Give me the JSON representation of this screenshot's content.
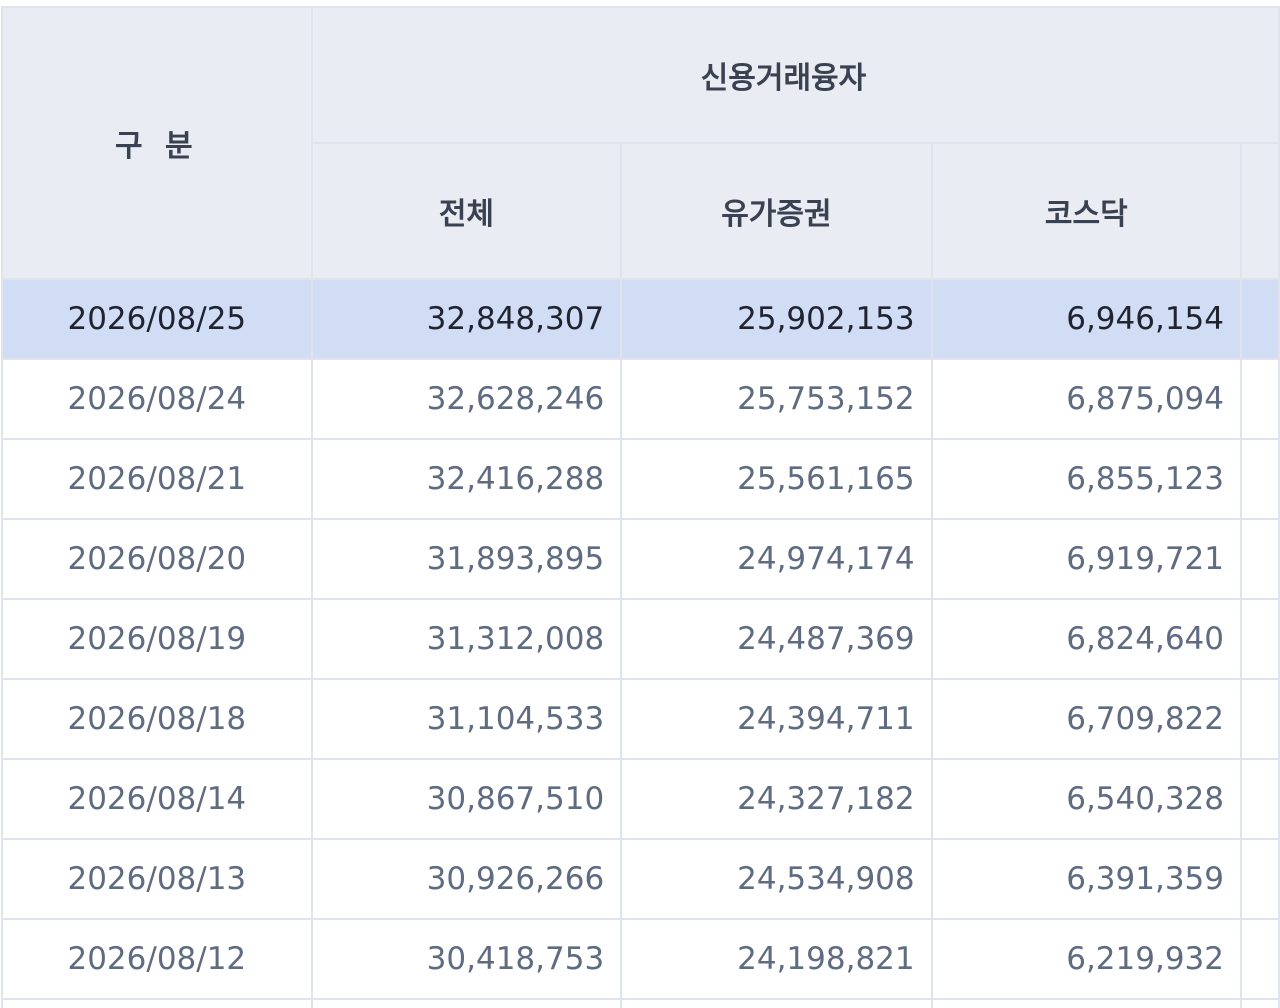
{
  "table": {
    "header": {
      "division_label": "구 분",
      "group_label": "신용거래융자",
      "sub_labels": [
        "전체",
        "유가증권",
        "코스닥"
      ]
    },
    "rows": [
      {
        "date": "2026/08/25",
        "total": "32,848,307",
        "kospi": "25,902,153",
        "kosdaq": "6,946,154",
        "selected": true
      },
      {
        "date": "2026/08/24",
        "total": "32,628,246",
        "kospi": "25,753,152",
        "kosdaq": "6,875,094"
      },
      {
        "date": "2026/08/21",
        "total": "32,416,288",
        "kospi": "25,561,165",
        "kosdaq": "6,855,123"
      },
      {
        "date": "2026/08/20",
        "total": "31,893,895",
        "kospi": "24,974,174",
        "kosdaq": "6,919,721"
      },
      {
        "date": "2026/08/19",
        "total": "31,312,008",
        "kospi": "24,487,369",
        "kosdaq": "6,824,640"
      },
      {
        "date": "2026/08/18",
        "total": "31,104,533",
        "kospi": "24,394,711",
        "kosdaq": "6,709,822"
      },
      {
        "date": "2026/08/14",
        "total": "30,867,510",
        "kospi": "24,327,182",
        "kosdaq": "6,540,328"
      },
      {
        "date": "2026/08/13",
        "total": "30,926,266",
        "kospi": "24,534,908",
        "kosdaq": "6,391,359"
      },
      {
        "date": "2026/08/12",
        "total": "30,418,753",
        "kospi": "24,198,821",
        "kosdaq": "6,219,932"
      }
    ]
  },
  "colors": {
    "header_bg": "#e9edf3",
    "border": "#dfe3ec",
    "selected_row_bg": "#d1ddf5",
    "text_muted": "#5f6b80",
    "text_dark": "#1f2430"
  }
}
